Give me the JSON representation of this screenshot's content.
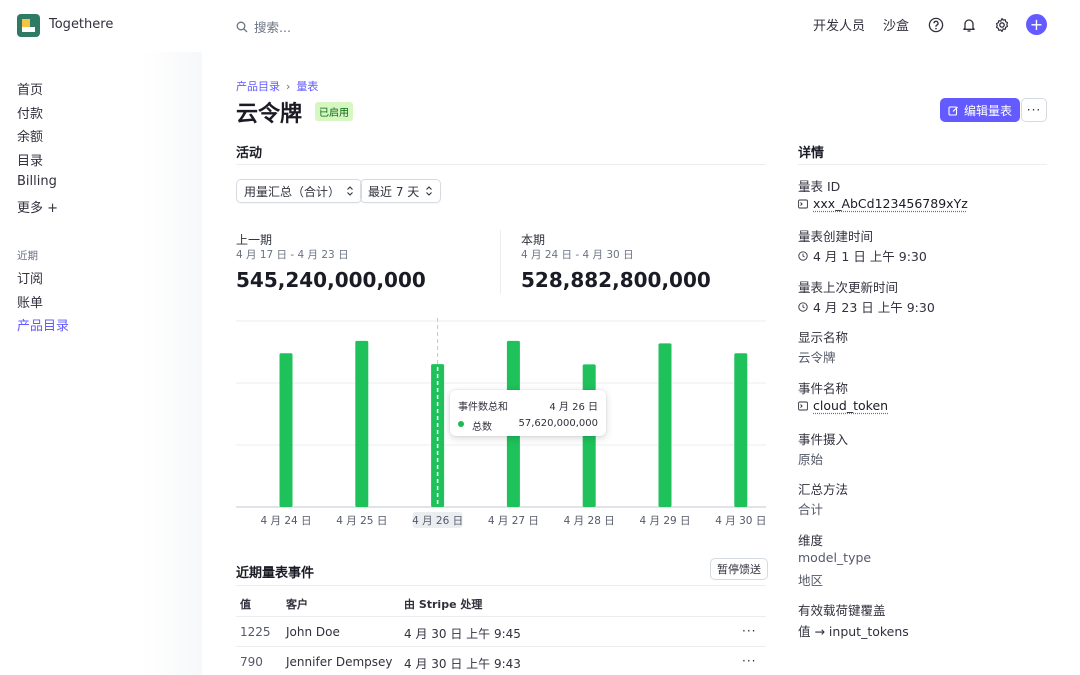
{
  "app": {
    "name": "Togethere"
  },
  "search": {
    "placeholder": "搜索..."
  },
  "topbar": {
    "developers": "开发人员",
    "sandbox": "沙盒",
    "help_icon": "help-icon",
    "bell_icon": "bell-icon",
    "settings_icon": "gear-icon",
    "plus_icon": "plus-icon",
    "plus": "+"
  },
  "sidebar": {
    "items": [
      "首页",
      "付款",
      "余额",
      "目录",
      "Billing",
      "更多 +"
    ],
    "recent_label": "近期",
    "recent_items": [
      "订阅",
      "账单",
      "产品目录"
    ]
  },
  "breadcrumb": {
    "parent": "产品目录",
    "sep": "›",
    "current": "量表"
  },
  "page": {
    "title": "云令牌",
    "status": "已启用",
    "edit_label": "编辑量表",
    "more": "···"
  },
  "activity": {
    "heading": "活动",
    "aggregation_select": "用量汇总（合计）",
    "range_select": "最近 7 天",
    "previous": {
      "label": "上一期",
      "range": "4 月 17 日 - 4 月 23 日",
      "value": "545,240,000,000"
    },
    "current": {
      "label": "本期",
      "range": "4 月 24 日 - 4 月 30 日",
      "value": "528,882,800,000"
    }
  },
  "colors": {
    "accent": "#635bff",
    "bar": "#1ec15a",
    "badge_bg": "#d7f7c2",
    "badge_fg": "#05690d"
  },
  "chart_data": {
    "type": "bar",
    "categories": [
      "4 月 24 日",
      "4 月 25 日",
      "4 月 26 日",
      "4 月 27 日",
      "4 月 28 日",
      "4 月 29 日",
      "4 月 30 日"
    ],
    "values": [
      62000000000,
      67000000000,
      57620000000,
      67000000000,
      57500000000,
      66000000000,
      62000000000
    ],
    "ylim": [
      0,
      75000000000
    ],
    "highlighted_category": "4 月 26 日",
    "grid": true,
    "tooltip": {
      "title": "事件数总和",
      "date": "4 月 26 日",
      "series": "总数",
      "value": "57,620,000,000"
    }
  },
  "events": {
    "heading": "近期量表事件",
    "pause_label": "暂停馈送",
    "columns": [
      "值",
      "客户",
      "由 Stripe 处理"
    ],
    "rows": [
      {
        "value": "1225",
        "customer": "John Doe",
        "processed": "4 月 30 日 上午 9:45",
        "more": "···"
      },
      {
        "value": "790",
        "customer": "Jennifer Dempsey",
        "processed": "4 月 30 日 上午 9:43",
        "more": "···"
      }
    ]
  },
  "details": {
    "heading": "详情",
    "meter_id_label": "量表 ID",
    "meter_id": "xxx_AbCd123456789xYz",
    "created_label": "量表创建时间",
    "created": "4 月 1 日 上午 9:30",
    "updated_label": "量表上次更新时间",
    "updated": "4 月 23 日 上午 9:30",
    "display_name_label": "显示名称",
    "display_name": "云令牌",
    "event_name_label": "事件名称",
    "event_name": "cloud_token",
    "ingestion_label": "事件摄入",
    "ingestion": "原始",
    "aggregation_label": "汇总方法",
    "aggregation": "合计",
    "dimensions_label": "维度",
    "dimensions": [
      "model_type",
      "地区"
    ],
    "payload_label": "有效载荷键覆盖",
    "payload": "值 → input_tokens"
  }
}
